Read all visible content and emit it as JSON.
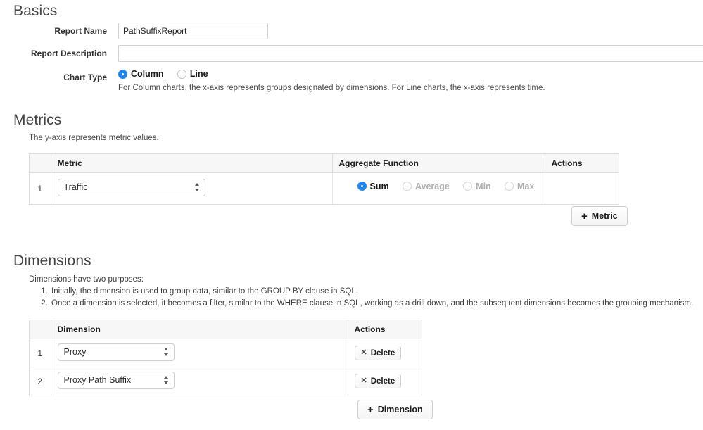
{
  "basics": {
    "section_title": "Basics",
    "report_name_label": "Report Name",
    "report_name_value": "PathSuffixReport",
    "report_name_placeholder": "",
    "report_description_label": "Report Description",
    "report_description_value": "",
    "report_description_placeholder": "",
    "chart_type_label": "Chart Type",
    "chart_type_options": [
      {
        "label": "Column",
        "checked": true,
        "disabled": false
      },
      {
        "label": "Line",
        "checked": false,
        "disabled": false
      }
    ],
    "chart_type_help": "For Column charts, the x-axis represents groups designated by dimensions. For Line charts, the x-axis represents time."
  },
  "metrics": {
    "section_title": "Metrics",
    "help": "The y-axis represents metric values.",
    "columns": [
      "",
      "Metric",
      "Aggregate Function",
      "Actions"
    ],
    "rows": [
      {
        "index": "1",
        "metric": "Traffic",
        "aggregate_options": [
          {
            "label": "Sum",
            "checked": true,
            "disabled": false
          },
          {
            "label": "Average",
            "checked": false,
            "disabled": true
          },
          {
            "label": "Min",
            "checked": false,
            "disabled": true
          },
          {
            "label": "Max",
            "checked": false,
            "disabled": true
          }
        ],
        "actions": ""
      }
    ],
    "add_button": "Metric",
    "add_button_icon": "plus-icon"
  },
  "dimensions": {
    "section_title": "Dimensions",
    "intro": "Dimensions have two purposes:",
    "points": [
      "Initially, the dimension is used to group data, similar to the GROUP BY clause in SQL.",
      "Once a dimension is selected, it becomes a filter, similar to the WHERE clause in SQL, working as a drill down, and the subsequent dimensions becomes the grouping mechanism."
    ],
    "columns": [
      "",
      "Dimension",
      "Actions"
    ],
    "rows": [
      {
        "index": "1",
        "dimension": "Proxy",
        "delete_label": "Delete"
      },
      {
        "index": "2",
        "dimension": "Proxy Path Suffix",
        "delete_label": "Delete"
      }
    ],
    "add_button": "Dimension",
    "add_button_icon": "plus-icon",
    "delete_icon": "close-x-icon"
  },
  "colors": {
    "accent": "#1a86f5",
    "border": "#dddddd",
    "header_bg": "#f7f7f7",
    "text": "#333333",
    "disabled_text": "#aeaeae"
  }
}
